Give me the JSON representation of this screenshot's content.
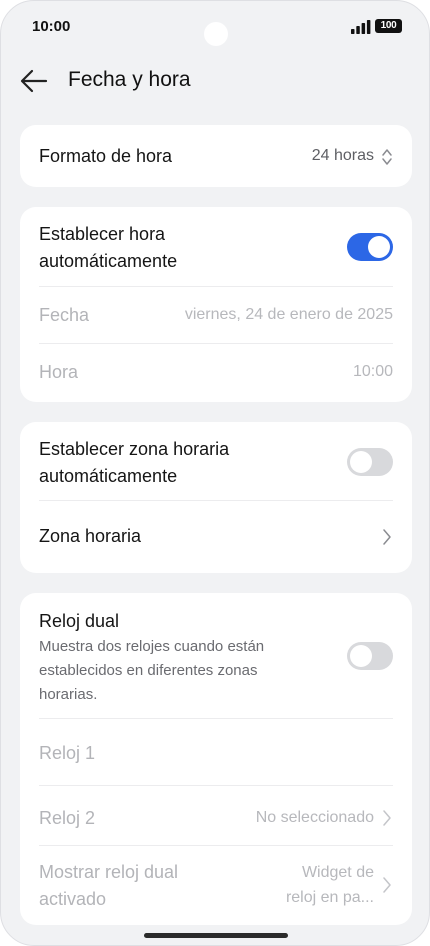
{
  "status_bar": {
    "time": "10:00",
    "battery": "100"
  },
  "header": {
    "title": "Fecha y hora"
  },
  "time_format": {
    "label": "Formato de hora",
    "value": "24 horas"
  },
  "auto_time": {
    "label_line1": "Establecer hora",
    "label_line2": "automáticamente",
    "enabled": true,
    "date_label": "Fecha",
    "date_value": "viernes, 24 de enero de 2025",
    "time_label": "Hora",
    "time_value": "10:00"
  },
  "auto_zone": {
    "label_line1": "Establecer zona horaria",
    "label_line2": "automáticamente",
    "enabled": false,
    "zone_label": "Zona horaria"
  },
  "dual_clock": {
    "label": "Reloj dual",
    "desc_line1": "Muestra dos relojes cuando están",
    "desc_line2": "establecidos en diferentes zonas",
    "desc_line3": "horarias.",
    "enabled": false,
    "clock1_label": "Reloj 1",
    "clock2_label": "Reloj 2",
    "clock2_value": "No seleccionado",
    "show_label_line1": "Mostrar reloj dual",
    "show_label_line2": "activado",
    "show_value_line1": "Widget de",
    "show_value_line2": "reloj en pa..."
  },
  "colors": {
    "accent": "#2c67e6",
    "background": "#f1f2f4",
    "card": "#ffffff"
  }
}
